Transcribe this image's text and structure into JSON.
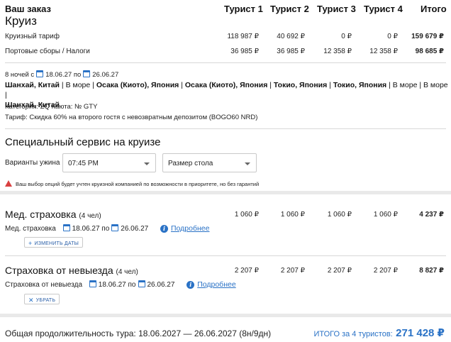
{
  "order": {
    "title": "Ваш заказ",
    "columns": [
      "Турист 1",
      "Турист 2",
      "Турист 3",
      "Турист 4",
      "Итого"
    ]
  },
  "cruise": {
    "title": "Круиз",
    "rows": [
      {
        "label": "Круизный тариф",
        "values": [
          "118 987 ₽",
          "40 692 ₽",
          "0 ₽",
          "0 ₽",
          "159 679 ₽"
        ]
      },
      {
        "label": "Портовые сборы / Налоги",
        "values": [
          "36 985 ₽",
          "36 985 ₽",
          "12 358 ₽",
          "12 358 ₽",
          "98 685 ₽"
        ]
      }
    ],
    "duration_prefix": "8 ночей с",
    "date_from": "18.06.27",
    "date_sep": "по",
    "date_to": "26.06.27",
    "ports_line1": [
      {
        "text": "Шанхай, Китай",
        "bold": true
      },
      {
        "text": " | В море | ",
        "bold": false
      },
      {
        "text": "Осака (Киото), Япония",
        "bold": true
      },
      {
        "text": " | ",
        "bold": false
      },
      {
        "text": "Осака (Киото), Япония",
        "bold": true
      },
      {
        "text": " | ",
        "bold": false
      },
      {
        "text": "Токио, Япония",
        "bold": true
      },
      {
        "text": " | ",
        "bold": false
      },
      {
        "text": "Токио, Япония",
        "bold": true
      },
      {
        "text": " | В море | В море |",
        "bold": false
      }
    ],
    "ports_line2": "Шанхай, Китай",
    "category_line": "Категория: ZQ   Каюта: № GTY",
    "tariff_line": "Тариф: Скидка 60% на второго гостя с невозвратным депозитом (BOGO60 NRD)"
  },
  "special": {
    "title": "Специальный сервис на круизе",
    "dinner_label": "Варианты ужина",
    "dinner_value": "07:45 PM",
    "table_value": "Размер стола",
    "warning": "Ваш выбор опций будет учтен круизной компанией по возможности в приоритете, но без гарантий"
  },
  "medical": {
    "title": "Мед. страховка",
    "count": "(4 чел)",
    "values": [
      "1 060 ₽",
      "1 060 ₽",
      "1 060 ₽",
      "1 060 ₽",
      "4 237 ₽"
    ],
    "sub_label": "Мед. страховка",
    "date_from": "18.06.27",
    "date_sep": "по",
    "date_to": "26.06.27",
    "more": "Подробнее",
    "button": "ИЗМЕНИТЬ ДАТЫ"
  },
  "cancel": {
    "title": "Страховка от невыезда",
    "count": "(4 чел)",
    "values": [
      "2 207 ₽",
      "2 207 ₽",
      "2 207 ₽",
      "2 207 ₽",
      "8 827 ₽"
    ],
    "sub_label": "Страховка от невыезда",
    "date_from": "18.06.27",
    "date_sep": "по",
    "date_to": "26.06.27",
    "more": "Подробнее",
    "button": "УБРАТЬ"
  },
  "footer": {
    "duration": "Общая продолжительность тура: 18.06.2027 — 26.06.2027 (8н/9дн)",
    "total_label": "ИТОГО за 4 туристов:",
    "total_value": "271 428 ₽"
  },
  "colors": {
    "accent": "#2a72c6",
    "warning": "#d94040",
    "divider": "#d8d8d8",
    "band": "#e9e9e9"
  },
  "icons": [
    "calendar-icon",
    "warning-icon",
    "info-icon",
    "plus-icon",
    "close-icon",
    "chevron-down-icon"
  ]
}
